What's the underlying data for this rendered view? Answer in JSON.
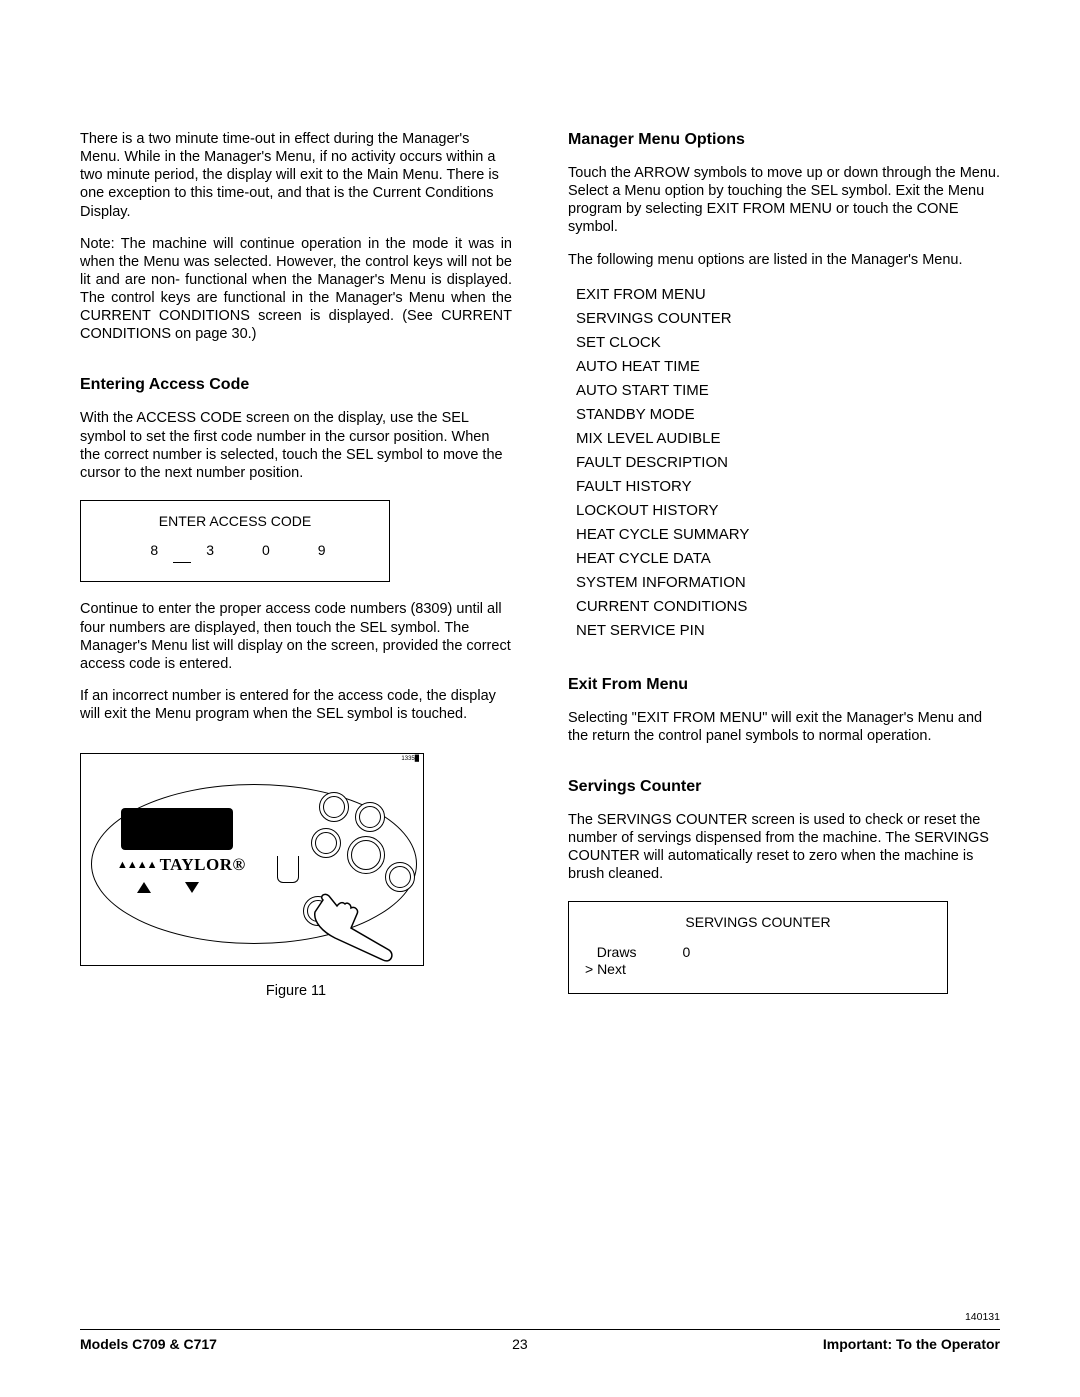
{
  "left": {
    "p1": "There is a two minute time-out in effect during the Manager's Menu. While in the Manager's Menu, if no activity occurs within a two minute period, the display will exit to the Main Menu. There is one exception to this time-out, and that is the Current Conditions Display.",
    "p2": "Note: The machine will continue operation in the mode it was in when the Menu was selected. However, the control keys will not be lit and are non- functional when the Manager's Menu is displayed. The control keys are functional in the Manager's Menu when the CURRENT CONDITIONS screen is displayed. (See CURRENT CONDITIONS on page 30.)",
    "h1": "Entering Access Code",
    "p3": "With the ACCESS CODE screen on the display, use the SEL symbol to set the first code number in the cursor position. When the correct number is selected, touch the SEL symbol to move the cursor to the next number position.",
    "lcd": {
      "title": "ENTER ACCESS CODE",
      "d1": "8",
      "d2": "3",
      "d3": "0",
      "d4": "9"
    },
    "p4": "Continue to enter the proper access code numbers (8309) until all four numbers are displayed, then touch the SEL symbol. The Manager's Menu list will display on the screen, provided the correct access code is entered.",
    "p5": "If an incorrect number is entered for the access code, the display will exit the Menu program when the SEL symbol is touched.",
    "figure": {
      "brand": "TAYLOR",
      "caption": "Figure 11"
    }
  },
  "right": {
    "h1": "Manager Menu Options",
    "p1": "Touch the ARROW symbols to move up or down through the Menu. Select a Menu option by touching the SEL symbol. Exit the Menu program by selecting EXIT FROM MENU or touch the CONE symbol.",
    "p2": "The following menu options are listed in the Manager's Menu.",
    "menu": [
      "EXIT FROM MENU",
      "SERVINGS COUNTER",
      "SET CLOCK",
      "AUTO HEAT TIME",
      "AUTO START TIME",
      "STANDBY MODE",
      "MIX LEVEL AUDIBLE",
      "FAULT DESCRIPTION",
      "FAULT HISTORY",
      "LOCKOUT HISTORY",
      "HEAT CYCLE SUMMARY",
      "HEAT CYCLE DATA",
      "SYSTEM INFORMATION",
      "CURRENT CONDITIONS",
      "NET SERVICE PIN"
    ],
    "h2": "Exit From Menu",
    "p3": "Selecting \"EXIT FROM MENU\" will exit the Manager's Menu and the return the control panel symbols to normal operation.",
    "h3": "Servings Counter",
    "p4": "The SERVINGS COUNTER screen is used to check or reset the number of servings dispensed from the machine. The SERVINGS COUNTER will automatically reset to zero when the machine is brush cleaned.",
    "lcd2": {
      "title": "SERVINGS COUNTER",
      "label1": "Draws",
      "value1": "0",
      "label2": "> Next"
    }
  },
  "footer": {
    "code": "140131",
    "left": "Models C709 & C717",
    "mid": "23",
    "right": "Important: To the Operator"
  }
}
